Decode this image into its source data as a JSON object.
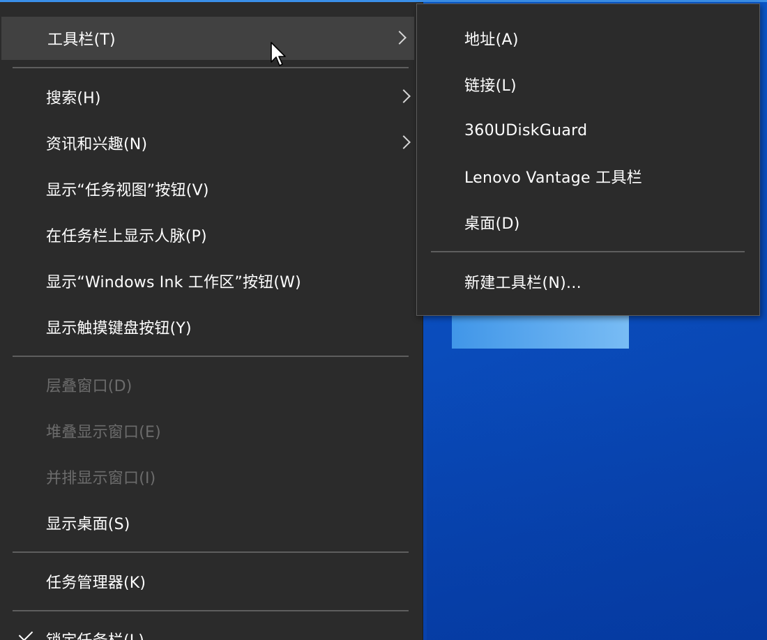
{
  "context_menu": {
    "items": [
      {
        "label": "工具栏(T)",
        "submenu": true,
        "hover": true
      },
      {
        "label": "搜索(H)",
        "submenu": true
      },
      {
        "label": "资讯和兴趣(N)",
        "submenu": true
      },
      {
        "label": "显示“任务视图”按钮(V)"
      },
      {
        "label": "在任务栏上显示人脉(P)"
      },
      {
        "label": "显示“Windows Ink 工作区”按钮(W)"
      },
      {
        "label": "显示触摸键盘按钮(Y)"
      },
      {
        "label": "层叠窗口(D)",
        "disabled": true
      },
      {
        "label": "堆叠显示窗口(E)",
        "disabled": true
      },
      {
        "label": "并排显示窗口(I)",
        "disabled": true
      },
      {
        "label": "显示桌面(S)"
      },
      {
        "label": "任务管理器(K)"
      },
      {
        "label": "锁定任务栏(L)",
        "checked": true
      }
    ]
  },
  "toolbar_submenu": {
    "items": [
      {
        "label": "地址(A)"
      },
      {
        "label": "链接(L)"
      },
      {
        "label": "360UDiskGuard"
      },
      {
        "label": "Lenovo Vantage 工具栏"
      },
      {
        "label": "桌面(D)"
      },
      {
        "label": "新建工具栏(N)..."
      }
    ]
  },
  "icons": {
    "submenu_arrow": "chevron-right-icon",
    "checkmark": "checkmark-icon",
    "cursor": "mouse-pointer-icon"
  },
  "colors": {
    "menu_bg": "#2b2b2b",
    "hover_bg": "#414141",
    "text": "#ffffff",
    "disabled_text": "#6c6c6c",
    "desktop_blue": "#0a56c8"
  }
}
